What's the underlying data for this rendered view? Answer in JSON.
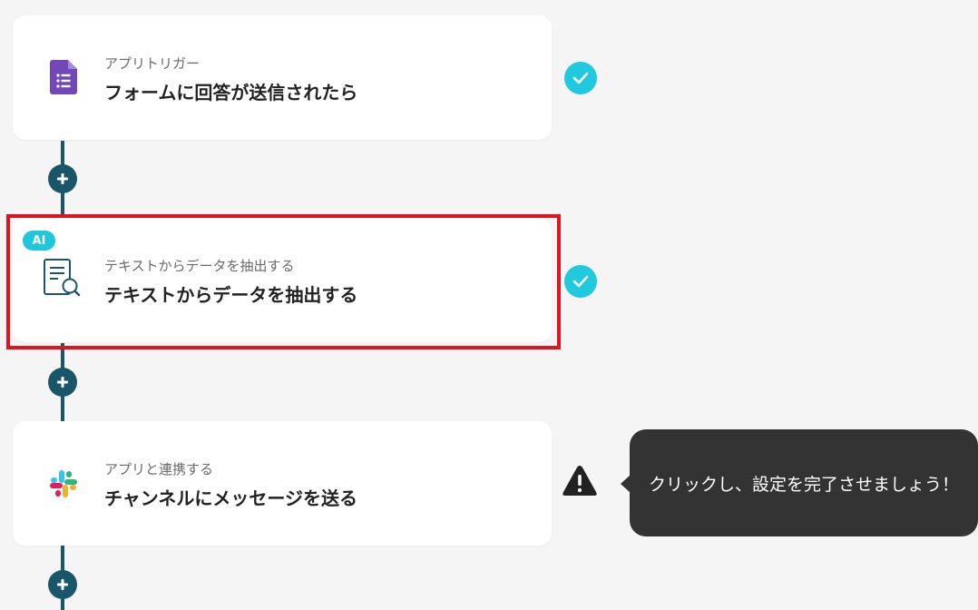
{
  "flow": {
    "steps": [
      {
        "subtitle": "アプリトリガー",
        "title": "フォームに回答が送信されたら",
        "icon": "google-forms-icon",
        "status": "complete"
      },
      {
        "badge": "AI",
        "subtitle": "テキストからデータを抽出する",
        "title": "テキストからデータを抽出する",
        "icon": "document-search-icon",
        "status": "complete",
        "highlighted": true
      },
      {
        "subtitle": "アプリと連携する",
        "title": "チャンネルにメッセージを送る",
        "icon": "slack-icon",
        "status": "warning"
      }
    ],
    "add_step_icon": "plus-icon"
  },
  "tooltip": {
    "text": "クリックし、設定を完了させましょう！"
  },
  "colors": {
    "background": "#f5f5f5",
    "connector": "#19566a",
    "check": "#20c9de",
    "ai_badge": "#1fc7dc",
    "highlight": "#e0141e",
    "tooltip_bg": "#333333",
    "forms_purple": "#7248b9"
  }
}
